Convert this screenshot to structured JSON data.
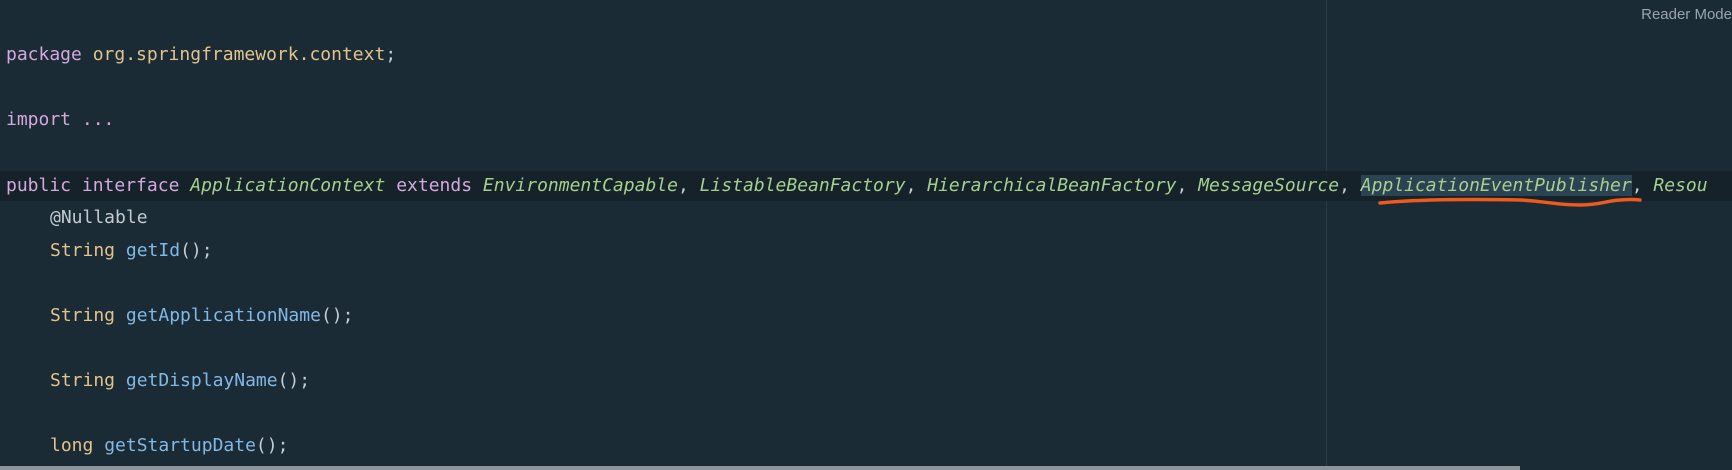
{
  "editor": {
    "reader_mode": "Reader Mode",
    "lines": {
      "package": {
        "keyword": "package",
        "name": "org.springframework.context",
        "semi": ";"
      },
      "import": {
        "keyword": "import",
        "folded": "..."
      },
      "decl": {
        "public": "public",
        "interface": "interface",
        "name": "ApplicationContext",
        "extends": "extends",
        "types": [
          "EnvironmentCapable",
          "ListableBeanFactory",
          "HierarchicalBeanFactory",
          "MessageSource",
          "ApplicationEventPublisher",
          "Resou"
        ],
        "sep": ", "
      },
      "nullable": "@Nullable",
      "getId": {
        "ret": "String",
        "name": "getId",
        "suffix": "();"
      },
      "getApplicationName": {
        "ret": "String",
        "name": "getApplicationName",
        "suffix": "();"
      },
      "getDisplayName": {
        "ret": "String",
        "name": "getDisplayName",
        "suffix": "();"
      },
      "getStartupDate": {
        "ret": "long",
        "name": "getStartupDate",
        "suffix": "();"
      }
    },
    "colors": {
      "background": "#1a2b35",
      "keyword": "#d5a8df",
      "type": "#a6cf8f",
      "method": "#82b8e6",
      "underline": "#f05a1a"
    }
  }
}
